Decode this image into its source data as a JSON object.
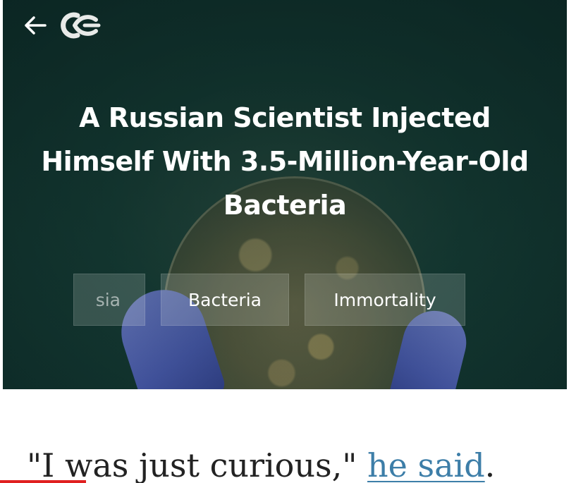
{
  "header": {
    "back_icon": "arrow-left-icon",
    "logo_icon": "curiosity-logo-icon"
  },
  "article": {
    "title": "A Russian Scientist Injected Himself With 3.5-Million-Year-Old Bacteria",
    "tags": [
      "sia",
      "Bacteria",
      "Immortality"
    ],
    "quote_text": "\"I was just curious,\" ",
    "quote_link": "he said",
    "quote_end": "."
  },
  "colors": {
    "hero_bg": "#153a33",
    "link": "#3d7ea8",
    "progress": "#e02020"
  }
}
